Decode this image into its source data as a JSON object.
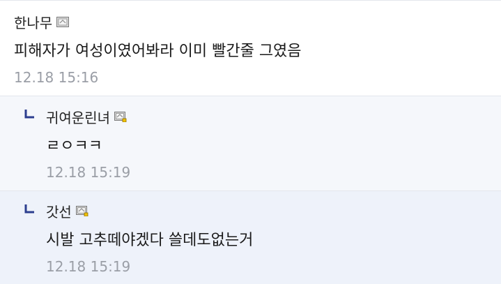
{
  "comments": [
    {
      "nickname": "한나무",
      "text": "피해자가 여성이였어봐라 이미 빨간줄 그였음",
      "time": "12.18 15:16",
      "badge": "gallog-icon"
    }
  ],
  "replies": [
    {
      "nickname": "귀여운린녀",
      "text": "ㄹㅇㅋㅋ",
      "time": "12.18 15:19",
      "badge": "fixed-nick-icon"
    },
    {
      "nickname": "갓선",
      "text": "시발 고추떼야겠다 쓸데도없는거",
      "time": "12.18 15:19",
      "badge": "fixed-nick-icon"
    }
  ],
  "colors": {
    "reply_bg": "#f5f7fb",
    "reply_bg_alt": "#eef2fa",
    "time": "#9a9ea6",
    "arrow": "#2c3e8f"
  }
}
